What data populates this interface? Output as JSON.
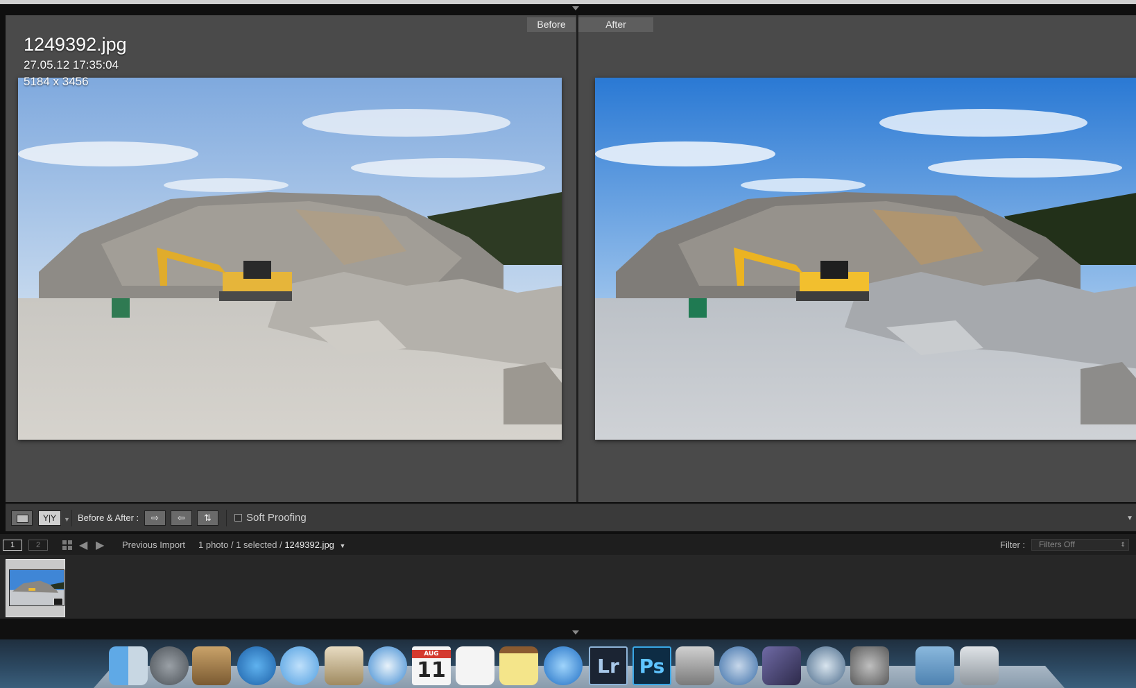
{
  "viewer": {
    "before_label": "Before",
    "after_label": "After",
    "info": {
      "filename": "1249392.jpg",
      "datetime": "27.05.12 17:35:04",
      "dimensions": "5184 x 3456"
    }
  },
  "toolbar": {
    "view_mode_label": "Y|Y",
    "before_after_label": "Before & After :",
    "swap_buttons": [
      "⇨",
      "⇦",
      "⇅"
    ],
    "soft_proofing_label": "Soft Proofing"
  },
  "filmbar": {
    "monitor1": "1",
    "monitor2": "2",
    "source": "Previous Import",
    "count_text": "1 photo / 1 selected /",
    "count_file": "1249392.jpg",
    "filter_label": "Filter :",
    "filter_value": "Filters Off"
  },
  "dock": {
    "calendar_month": "AUG",
    "calendar_day": "11",
    "lightroom": "Lr",
    "photoshop": "Ps",
    "items": [
      "finder-icon",
      "launchpad-icon",
      "photo-browser-icon",
      "app-store-icon",
      "messages-icon",
      "mail-icon",
      "safari-icon",
      "calendar-icon",
      "reminders-icon",
      "notes-icon",
      "itunes-icon",
      "lightroom-icon",
      "photoshop-icon",
      "preview-app-icon",
      "quicktime-icon",
      "pen-app-icon",
      "scope-app-icon",
      "system-preferences-icon",
      "applications-folder-icon",
      "trash-icon"
    ]
  }
}
